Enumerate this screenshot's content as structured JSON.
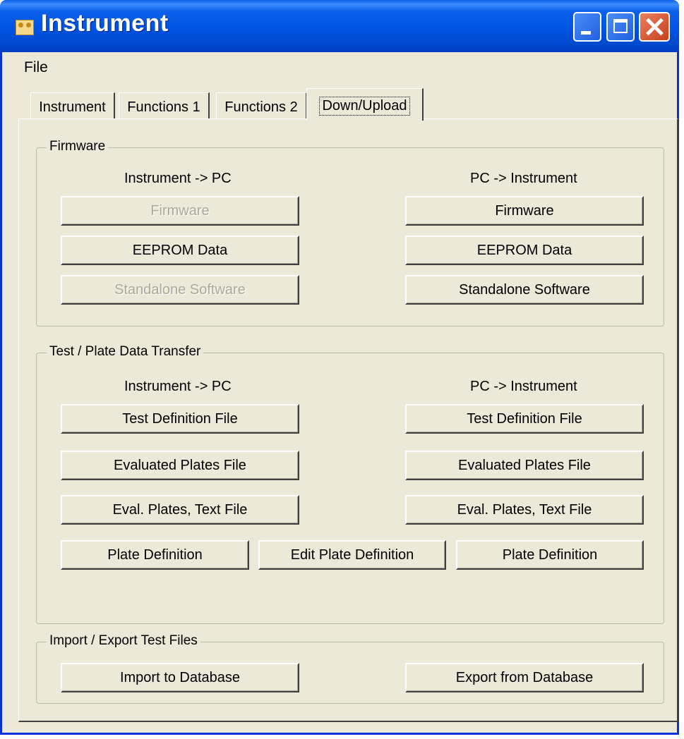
{
  "window": {
    "title": "Instrument"
  },
  "menu": {
    "file": "File"
  },
  "tabs": [
    "Instrument",
    "Functions 1",
    "Functions 2",
    "Down/Upload"
  ],
  "firmware_group": {
    "legend": "Firmware",
    "left_heading": "Instrument -> PC",
    "right_heading": "PC -> Instrument",
    "left_buttons": [
      "Firmware",
      "EEPROM Data",
      "Standalone Software"
    ],
    "right_buttons": [
      "Firmware",
      "EEPROM Data",
      "Standalone Software"
    ]
  },
  "test_group": {
    "legend": "Test / Plate Data Transfer",
    "left_heading": "Instrument -> PC",
    "right_heading": "PC -> Instrument",
    "left_buttons": [
      "Test Definition File",
      "Evaluated Plates File",
      "Eval. Plates, Text File"
    ],
    "right_buttons": [
      "Test Definition File",
      "Evaluated Plates File",
      "Eval. Plates, Text File"
    ],
    "plate_left": "Plate Definition",
    "plate_edit": "Edit Plate Definition",
    "plate_right": "Plate Definition"
  },
  "import_group": {
    "legend": "Import / Export Test Files",
    "import": "Import to Database",
    "export": "Export from Database"
  },
  "colors": {
    "titlebar": "#0054e3",
    "face": "#ece9d8",
    "disabled_text": "#aca899"
  }
}
